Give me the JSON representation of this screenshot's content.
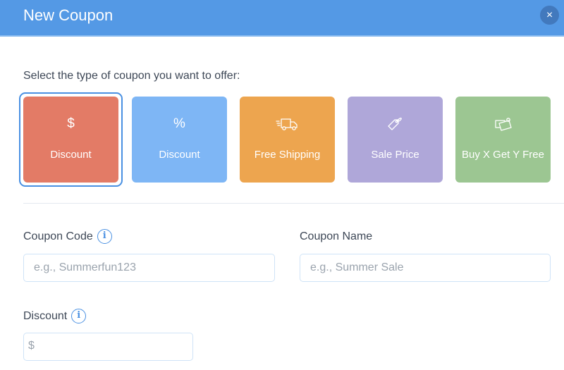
{
  "dialog": {
    "title": "New Coupon",
    "close_label": "×",
    "header_color": "#5499e5"
  },
  "type_selector": {
    "prompt": "Select the type of coupon you want to offer:",
    "selected_index": 0,
    "options": [
      {
        "icon": "dollar-icon",
        "glyph": "$",
        "label": "Discount",
        "color": "#e37b66"
      },
      {
        "icon": "percent-icon",
        "glyph": "%",
        "label": "Discount",
        "color": "#7eb6f5"
      },
      {
        "icon": "truck-icon",
        "glyph": "",
        "label": "Free Shipping",
        "color": "#eda54f"
      },
      {
        "icon": "tag-icon",
        "glyph": "",
        "label": "Sale Price",
        "color": "#afa7d9"
      },
      {
        "icon": "gift-card-icon",
        "glyph": "",
        "label": "Buy X Get Y Free",
        "color": "#9cc692"
      }
    ]
  },
  "form": {
    "coupon_code": {
      "label": "Coupon Code",
      "placeholder": "e.g., Summerfun123",
      "value": ""
    },
    "coupon_name": {
      "label": "Coupon Name",
      "placeholder": "e.g., Summer Sale",
      "value": ""
    },
    "discount": {
      "label": "Discount",
      "prefix": "$",
      "value": ""
    },
    "info_glyph": "i"
  }
}
